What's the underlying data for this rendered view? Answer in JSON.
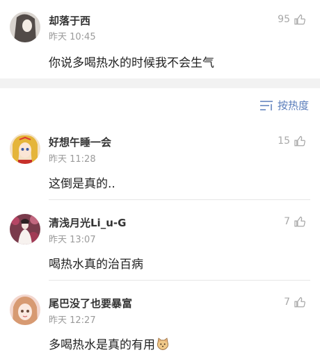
{
  "top_comment": {
    "username": "却落于西",
    "time": "昨天 10:45",
    "text": "你说多喝热水的时候我不会生气",
    "likes": "95",
    "like_icon": "thumbs-up-icon"
  },
  "sort_control": {
    "label": "按热度",
    "icon": "sort-lines-icon"
  },
  "replies": [
    {
      "username": "好想午睡一会",
      "time": "昨天 11:28",
      "text": "这倒是真的..",
      "likes": "15"
    },
    {
      "username": "清浅月光Li_u-G",
      "time": "昨天 13:07",
      "text": "喝热水真的治百病",
      "likes": "7"
    },
    {
      "username": "尾巴没了也要暴富",
      "time": "昨天 12:27",
      "text": "多喝热水是真的有用",
      "likes": "7",
      "trailing_emoji": "cat-face-icon"
    }
  ],
  "colors": {
    "accent": "#5a7dbb",
    "muted": "#9a9a9a",
    "separator": "#f2f2f2"
  }
}
